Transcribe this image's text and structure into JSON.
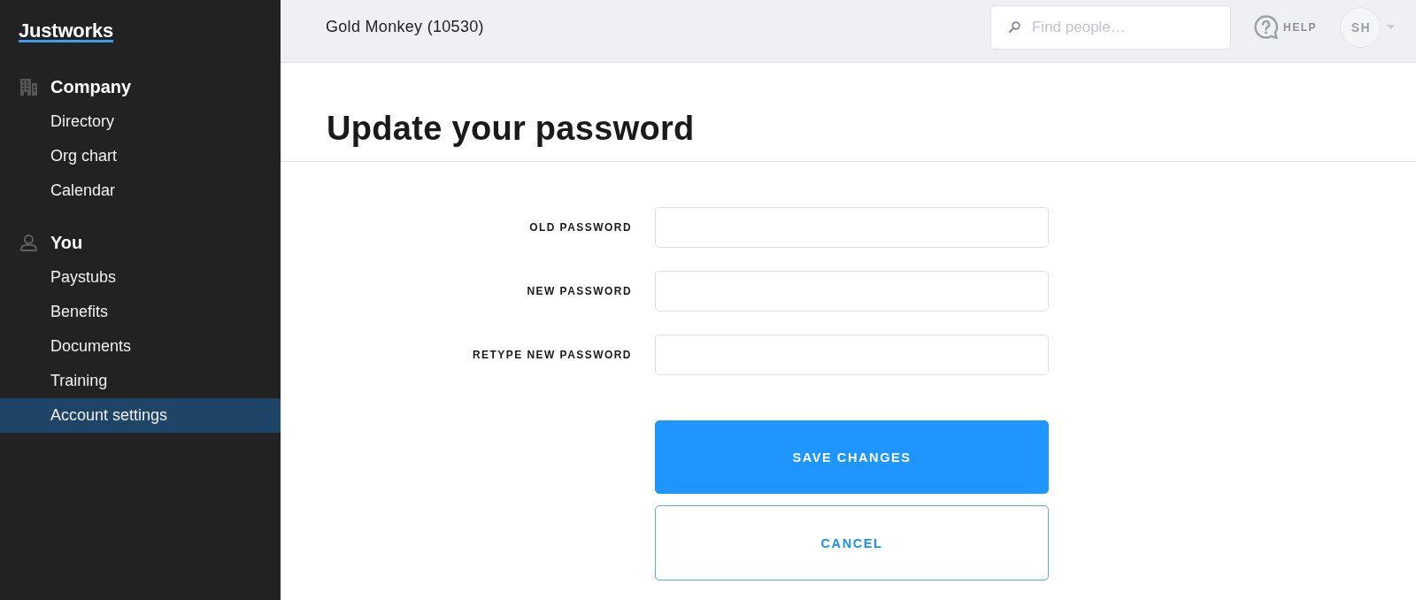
{
  "sidebar": {
    "logo": "Justworks",
    "sections": [
      {
        "kind": "company",
        "title": "Company",
        "items": [
          {
            "label": "Directory",
            "selected": false
          },
          {
            "label": "Org chart",
            "selected": false
          },
          {
            "label": "Calendar",
            "selected": false
          }
        ]
      },
      {
        "kind": "person",
        "title": "You",
        "items": [
          {
            "label": "Paystubs",
            "selected": false
          },
          {
            "label": "Benefits",
            "selected": false
          },
          {
            "label": "Documents",
            "selected": false
          },
          {
            "label": "Training",
            "selected": false
          },
          {
            "label": "Account settings",
            "selected": true
          }
        ]
      }
    ]
  },
  "top_bar": {
    "company": "Gold Monkey (10530)",
    "search": {
      "placeholder": "Find people…"
    },
    "help": "HELP",
    "avatar": "SH"
  },
  "page": {
    "title": "Update your password"
  },
  "form": {
    "fields": [
      {
        "label": "OLD PASSWORD"
      },
      {
        "label": "NEW PASSWORD"
      },
      {
        "label": "RETYPE NEW PASSWORD"
      }
    ],
    "buttons": [
      {
        "kind": "primary",
        "label": "SAVE CHANGES"
      },
      {
        "kind": "secondary",
        "label": "CANCEL"
      }
    ]
  }
}
